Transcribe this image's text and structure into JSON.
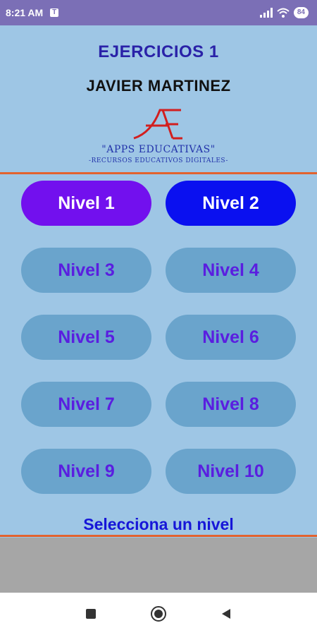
{
  "status": {
    "time": "8:21 AM",
    "notification_icon": "T",
    "battery": "84"
  },
  "header": {
    "title": "EJERCICIOS 1",
    "author": "JAVIER MARTINEZ",
    "logo_text": "\"APPS EDUCATIVAS\"",
    "logo_subtext": "-RECURSOS EDUCATIVOS DIGITALES-"
  },
  "levels": [
    {
      "label": "Nivel 1",
      "state": "unlocked-a"
    },
    {
      "label": "Nivel 2",
      "state": "unlocked-b"
    },
    {
      "label": "Nivel 3",
      "state": "locked"
    },
    {
      "label": "Nivel 4",
      "state": "locked"
    },
    {
      "label": "Nivel 5",
      "state": "locked"
    },
    {
      "label": "Nivel 6",
      "state": "locked"
    },
    {
      "label": "Nivel 7",
      "state": "locked"
    },
    {
      "label": "Nivel 8",
      "state": "locked"
    },
    {
      "label": "Nivel 9",
      "state": "locked"
    },
    {
      "label": "Nivel 10",
      "state": "locked"
    }
  ],
  "prompt": "Selecciona un nivel",
  "colors": {
    "status_bar": "#7b6fb6",
    "background": "#9ec6e5",
    "divider": "#e2622f",
    "level1": "#7210ee",
    "level2": "#0a10f0",
    "locked": "#6aa4cc",
    "locked_text": "#5a1ee0"
  },
  "icons": {
    "signal": "signal-icon",
    "wifi": "wifi-icon",
    "nav_recent": "square-icon",
    "nav_home": "circle-icon",
    "nav_back": "triangle-back-icon"
  }
}
